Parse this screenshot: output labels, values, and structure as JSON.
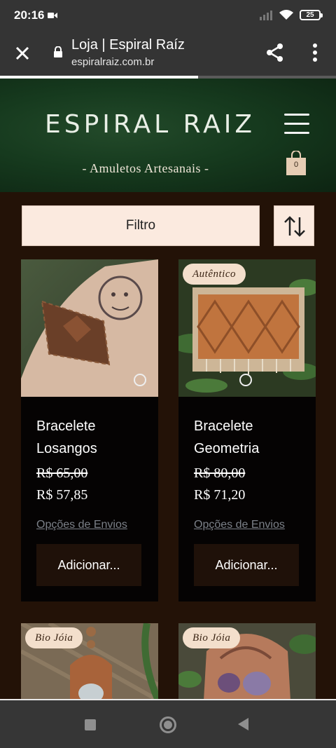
{
  "status": {
    "time": "20:16",
    "battery": "25"
  },
  "browser": {
    "title": "Loja | Espiral Raíz",
    "url": "espiralraiz.com.br",
    "load_progress": 0.59
  },
  "site": {
    "logo": "ESPIRAL RAIZ",
    "tagline": "- Amuletos Artesanais -",
    "cart_count": "0"
  },
  "filter": {
    "label": "Filtro"
  },
  "products": [
    {
      "name_line1": "Bracelete",
      "name_line2": "Losangos",
      "old_price": "R$ 65,00",
      "price": "R$ 57,85",
      "shipping_link": "Opções de Envios",
      "add_label": "Adicionar..."
    },
    {
      "badge": "Autêntico",
      "name_line1": "Bracelete",
      "name_line2": "Geometria",
      "old_price": "R$ 80,00",
      "price": "R$ 71,20",
      "shipping_link": "Opções de Envios",
      "add_label": "Adicionar..."
    },
    {
      "badge": "Bio Jóia"
    },
    {
      "badge": "Bio Jóia"
    }
  ],
  "colors": {
    "page_bg": "#231207",
    "header_green": "#163a1e",
    "button_bg": "#fbeadf",
    "card_bg": "#050303",
    "link_gray": "#7b8088"
  }
}
